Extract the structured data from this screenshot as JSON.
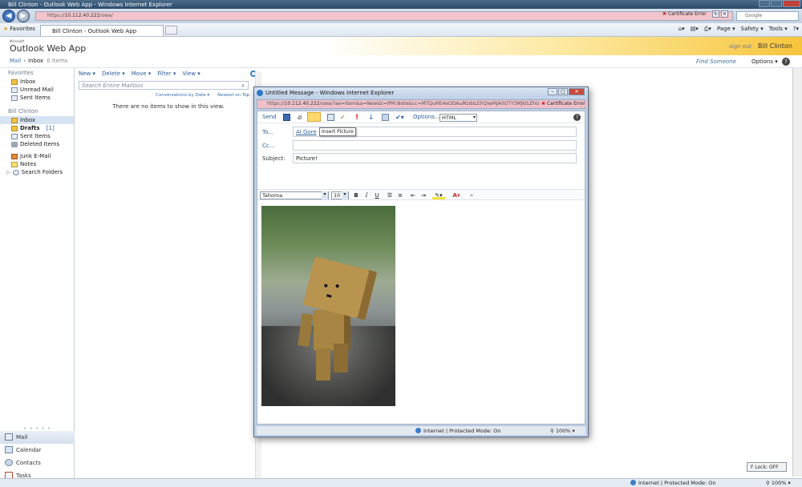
{
  "browser": {
    "title": "Bill Clinton - Outlook Web App - Windows Internet Explorer",
    "address_host": "10.112.40.222",
    "address_prefix": "https://",
    "address_path": "/owa/",
    "cert_error": "Certificate Error",
    "search_placeholder": "Google",
    "favorites_label": "Favorites",
    "tab_title": "Bill Clinton - Outlook Web App",
    "commands": [
      "Page ▾",
      "Safety ▾",
      "Tools ▾"
    ],
    "status_zone": "Internet | Protected Mode: On",
    "zoom": "100%",
    "flock": "F Lock: OFF"
  },
  "owa": {
    "logo_small": "Microsoft",
    "logo": "Outlook Web App",
    "signout": "sign out",
    "user": "Bill Clinton",
    "crumb_mail": "Mail",
    "crumb_inbox": "Inbox",
    "crumb_count": "0 Items",
    "find_someone": "Find Someone",
    "options": "Options ▾",
    "help": "?"
  },
  "nav": {
    "favorites_header": "Favorites",
    "favorites": [
      "Inbox",
      "Unread Mail",
      "Sent Items"
    ],
    "mailbox_header": "Bill Clinton",
    "folders": [
      "Inbox",
      "Drafts",
      "Sent Items",
      "Deleted Items"
    ],
    "drafts_count": "[1]",
    "other_folders": [
      "Junk E-Mail",
      "Notes",
      "Search Folders"
    ],
    "grip": "• • • • •",
    "modules": [
      "Mail",
      "Calendar",
      "Contacts",
      "Tasks"
    ]
  },
  "list": {
    "toolbar": [
      "New ▾",
      "Delete ▾",
      "Move ▾",
      "Filter ▾",
      "View ▾"
    ],
    "search_placeholder": "Search Entire Mailbox",
    "sort_by": "Conversations by Date ▾",
    "sort_order": "Newest on Top",
    "empty": "There are no items to show in this view."
  },
  "popup": {
    "title": "Untitled Message - Windows Internet Explorer",
    "address_host": "10.112.40.222",
    "address_prefix": "https://",
    "address_path": "/owa/?ae=Item&a=New&t=IPM.Note&cc=MTQuMS4xODAuMzdsLEhQiwMjA0OTY3MjktLEhUUwo",
    "cert_error": "Certificate Error",
    "send": "Send",
    "options": "Options...",
    "format": "HTML",
    "tooltip": "Insert Picture",
    "to_label": "To...",
    "to_value": "Al Gore",
    "cc_label": "Cc...",
    "subject_label": "Subject:",
    "subject_value": "Picture!",
    "font": "Tahoma",
    "size": "10",
    "status_zone": "Internet | Protected Mode: On",
    "zoom": "100%"
  }
}
